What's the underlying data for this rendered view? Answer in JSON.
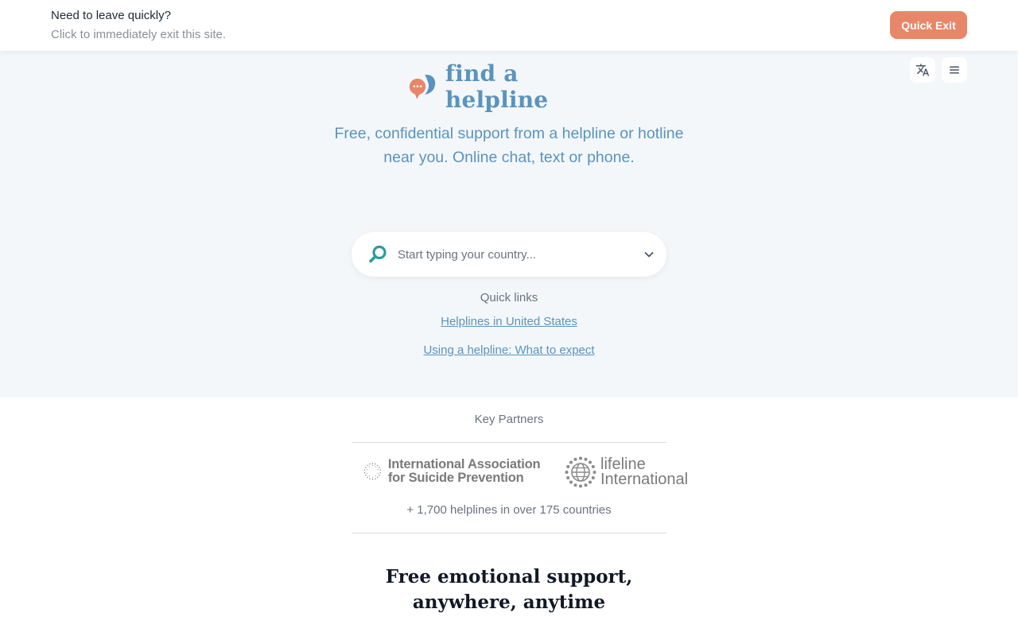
{
  "quick_exit_bar": {
    "title": "Need to leave quickly?",
    "subtitle": "Click to immediately exit this site.",
    "button_label": "Quick Exit",
    "button_color": "#e8866a"
  },
  "toolbar": {
    "translate_icon": "translate-icon",
    "menu_icon": "hamburger-menu-icon"
  },
  "brand": {
    "name": "find a helpline",
    "color": "#5a93bd",
    "accent": "#e8866a"
  },
  "hero": {
    "tagline": "Free, confidential support from a helpline or hotline near you. Online chat, text or phone."
  },
  "search": {
    "placeholder": "Start typing your country...",
    "value": "",
    "icon": "search-icon",
    "dropdown_icon": "chevron-down-icon"
  },
  "quick_links": {
    "title": "Quick links",
    "links": [
      {
        "label": "Helplines in United States"
      },
      {
        "label": "Using a helpline: What to expect"
      }
    ]
  },
  "partners": {
    "title": "Key Partners",
    "iasp_logo": "International Association for Suicide Prevention",
    "lifeline_logo": "lifeline International",
    "count_text": "+ 1,700 helplines in over 175 countries"
  },
  "section": {
    "title_line1": "Free emotional support,",
    "title_line2": "anywhere, anytime"
  }
}
